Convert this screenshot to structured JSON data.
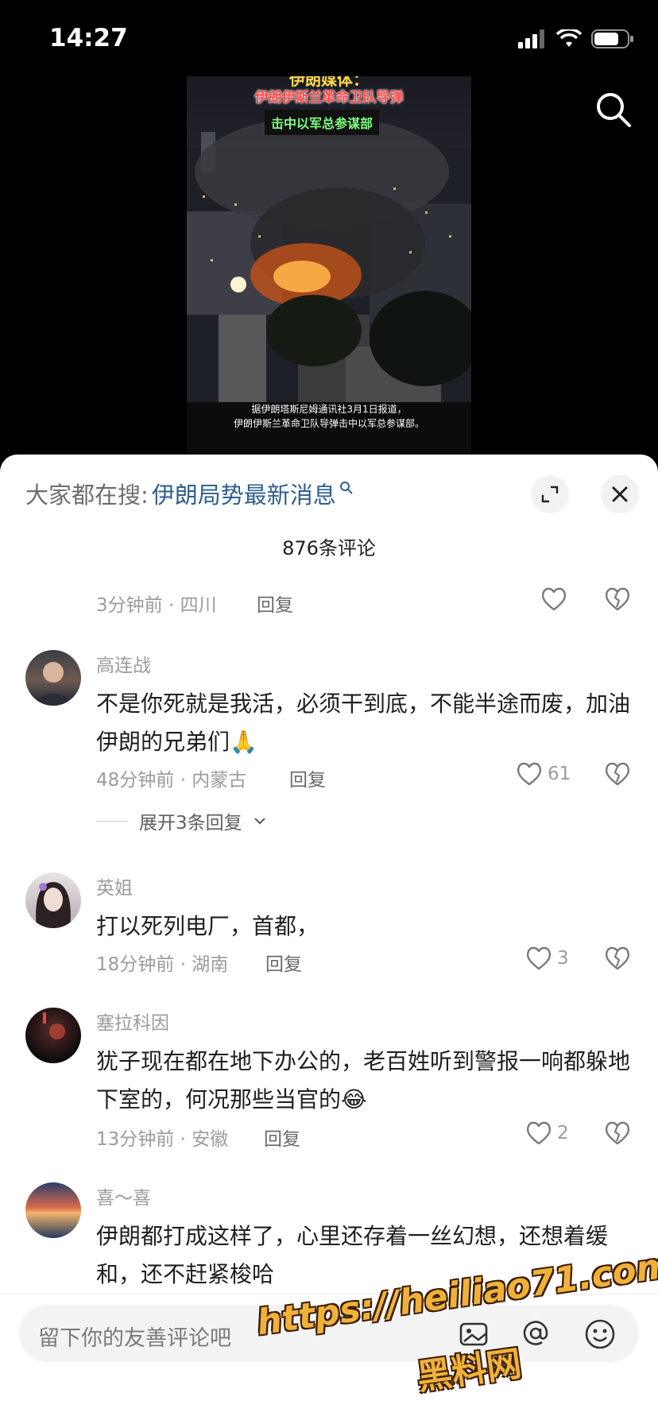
{
  "status": {
    "time": "14:27"
  },
  "video": {
    "caption_top_partial": "伊朗媒体：",
    "caption_title_1": "伊朗伊斯兰革命卫队导弹",
    "caption_title_2": "击中以军总参谋部",
    "subtitle_line_1": "据伊朗塔斯尼姆通讯社3月1日报道，",
    "subtitle_line_2": "伊朗伊斯兰革命卫队导弹击中以军总参谋部。"
  },
  "panel": {
    "trend_prefix": "大家都在搜:",
    "trend_link": "伊朗局势最新消息",
    "comment_count": "876条评论"
  },
  "comments": [
    {
      "time_location": "3分钟前 · 四川",
      "reply_label": "回复",
      "like_count": ""
    },
    {
      "username": "高连战",
      "text": "不是你死就是我活，必须干到底，不能半途而废，加油伊朗的兄弟们🙏",
      "time_location": "48分钟前 · 内蒙古",
      "reply_label": "回复",
      "like_count": "61",
      "expand_label": "展开3条回复"
    },
    {
      "username": "英姐",
      "text": "打以死列电厂，首都，",
      "time_location": "18分钟前 · 湖南",
      "reply_label": "回复",
      "like_count": "3"
    },
    {
      "username": "塞拉科因",
      "text": "犹子现在都在地下办公的，老百姓听到警报一响都躲地下室的，何况那些当官的😂",
      "time_location": "13分钟前 · 安徽",
      "reply_label": "回复",
      "like_count": "2"
    },
    {
      "username": "喜～喜",
      "text": "伊朗都打成这样了，心里还存着一丝幻想，还想着缓和，还不赶紧梭哈"
    }
  ],
  "input": {
    "placeholder": "留下你的友善评论吧"
  },
  "watermark": {
    "url": "https://heiliao71.com",
    "text": "黑料网"
  },
  "colors": {
    "link": "#2d5f8e",
    "meta": "#9b9b9b",
    "caption_red": "#ff3b3b",
    "caption_green": "#7dff7d"
  }
}
